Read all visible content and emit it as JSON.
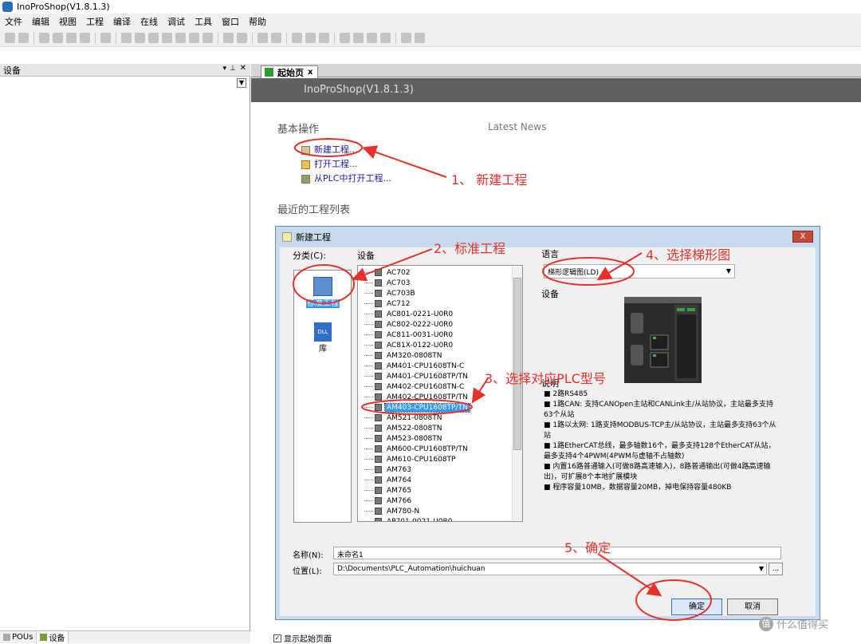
{
  "window": {
    "title": "InoProShop(V1.8.1.3)"
  },
  "menu": [
    "文件",
    "编辑",
    "视图",
    "工程",
    "编译",
    "在线",
    "调试",
    "工具",
    "窗口",
    "帮助"
  ],
  "left_panel": {
    "title": "设备",
    "tabs": [
      {
        "label": "POUs"
      },
      {
        "label": "设备"
      }
    ]
  },
  "doc_tab": {
    "label": "起始页",
    "close": "x"
  },
  "start_page": {
    "banner": "InoProShop(V1.8.1.3)",
    "basic_ops_heading": "基本操作",
    "latest_news": "Latest News",
    "links": [
      "新建工程...",
      "打开工程...",
      "从PLC中打开工程..."
    ],
    "recent_heading": "最近的工程列表",
    "show_start_label": "显示起始页面"
  },
  "dialog": {
    "title": "新建工程",
    "close": "X",
    "category_label": "分类(C):",
    "device_label": "设备",
    "categories": [
      {
        "label": "标准工程"
      },
      {
        "label": "库"
      }
    ],
    "dll_text": "DLL",
    "devices": [
      "AC702",
      "AC703",
      "AC703B",
      "AC712",
      "AC801-0221-U0R0",
      "AC802-0222-U0R0",
      "AC811-0031-U0R0",
      "AC81X-0122-U0R0",
      "AM320-0808TN",
      "AM401-CPU1608TN-C",
      "AM401-CPU1608TP/TN",
      "AM402-CPU1608TN-C",
      "AM402-CPU1608TP/TN",
      "AM403-CPU1608TP/TN",
      "AM521-0808TN",
      "AM522-0808TN",
      "AM523-0808TN",
      "AM600-CPU1608TP/TN",
      "AM610-CPU1608TP",
      "AM763",
      "AM764",
      "AM765",
      "AM766",
      "AM780-N",
      "AP701-0021-U0R0"
    ],
    "selected_device": "AM403-CPU1608TP/TN",
    "language_label": "语言",
    "language_value": "梯形逻辑图(LD)",
    "device_section_label": "设备",
    "description_label": "说明",
    "description": [
      "■  2路RS485",
      "■  1路CAN: 支持CANOpen主站和CANLink主/从站协议，主站最多支持63个从站",
      "■  1路以太网: 1路支持MODBUS-TCP主/从站协议，主站最多支持63个从站",
      "■  1路EtherCAT总线，最多轴数16个，最多支持128个EtherCAT从站，最多支持4个4PWM(4PWM与虚轴不占轴数)",
      "■  内置16路普通输入(可做8路高速输入)，8路普通输出(可做4路高速输出)，可扩展8个本地扩展模块",
      "■  程序容量10MB，数据容量20MB，掉电保持容量480KB"
    ],
    "name_label": "名称(N):",
    "name_value": "未命名1",
    "location_label": "位置(L):",
    "location_value": "D:\\Documents\\PLC_Automation\\huichuan",
    "browse": "...",
    "ok": "确定",
    "cancel": "取消"
  },
  "annotations": [
    "1、 新建工程",
    "2、标准工程",
    "3、选择对应PLC型号",
    "4、选择梯形图",
    "5、确定"
  ],
  "watermark": "什么值得买",
  "watermark_glyph": "值",
  "colors": {
    "annotation": "#e8302a",
    "banner_bg": "#606060",
    "selection": "#3399ff"
  }
}
